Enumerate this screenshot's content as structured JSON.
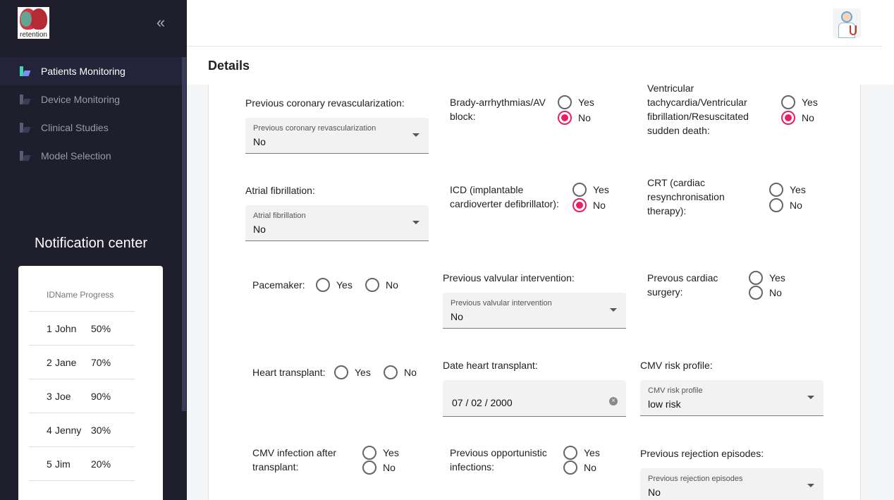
{
  "logo": {
    "text": "retention"
  },
  "sidebar": {
    "items": [
      {
        "label": "Patients Monitoring"
      },
      {
        "label": "Device Monitoring"
      },
      {
        "label": "Clinical Studies"
      },
      {
        "label": "Model Selection"
      }
    ]
  },
  "notifications": {
    "title": "Notification center",
    "columns": [
      "ID",
      "Name",
      "Progress"
    ],
    "rows": [
      {
        "id": "1",
        "name": "John",
        "progress": "50%"
      },
      {
        "id": "2",
        "name": "Jane",
        "progress": "70%"
      },
      {
        "id": "3",
        "name": "Joe",
        "progress": "90%"
      },
      {
        "id": "4",
        "name": "Jenny",
        "progress": "30%"
      },
      {
        "id": "5",
        "name": "Jim",
        "progress": "20%"
      }
    ]
  },
  "page": {
    "title": "Details"
  },
  "radio_labels": {
    "yes": "Yes",
    "no": "No"
  },
  "form": {
    "prev_revasc": {
      "label": "Previous coronary revascularization:",
      "select_label": "Previous coronary revascularization",
      "value": "No"
    },
    "brady": {
      "label": "Brady-arrhythmias/AV block:",
      "value": "No"
    },
    "vt": {
      "label": "Ventricular tachycardia/Ventricular fibrillation/Resuscitated sudden death:",
      "value": "No"
    },
    "af": {
      "label": "Atrial fibrillation:",
      "select_label": "Atrial fibrillation",
      "value": "No"
    },
    "icd": {
      "label": "ICD (implantable cardioverter defibrillator):",
      "value": "No"
    },
    "crt": {
      "label": "CRT (cardiac resynchronisation therapy):",
      "value": ""
    },
    "pacemaker": {
      "label": "Pacemaker:",
      "value": ""
    },
    "valvular": {
      "label": "Previous valvular intervention:",
      "select_label": "Previous valvular intervention",
      "value": "No"
    },
    "cardiac_surgery": {
      "label": "Prevous cardiac surgery:",
      "value": ""
    },
    "heart_tx": {
      "label": "Heart transplant:",
      "value": ""
    },
    "date_tx": {
      "label": "Date heart transplant:",
      "value": "07 / 02 / 2000"
    },
    "cmv_risk": {
      "label": "CMV risk profile:",
      "select_label": "CMV risk profile",
      "value": "low risk"
    },
    "cmv_infection": {
      "label": "CMV infection after transplant:",
      "value": ""
    },
    "opportunistic": {
      "label": "Previous opportunistic infections:",
      "value": ""
    },
    "rejection": {
      "label": "Previous rejection episodes:",
      "select_label": "Previous rejection episodes",
      "value": "No"
    }
  },
  "colors": {
    "sidebar_bg": "#1e1e2c",
    "accent": "#e91e63",
    "active_icon": "#3ed6b5"
  }
}
